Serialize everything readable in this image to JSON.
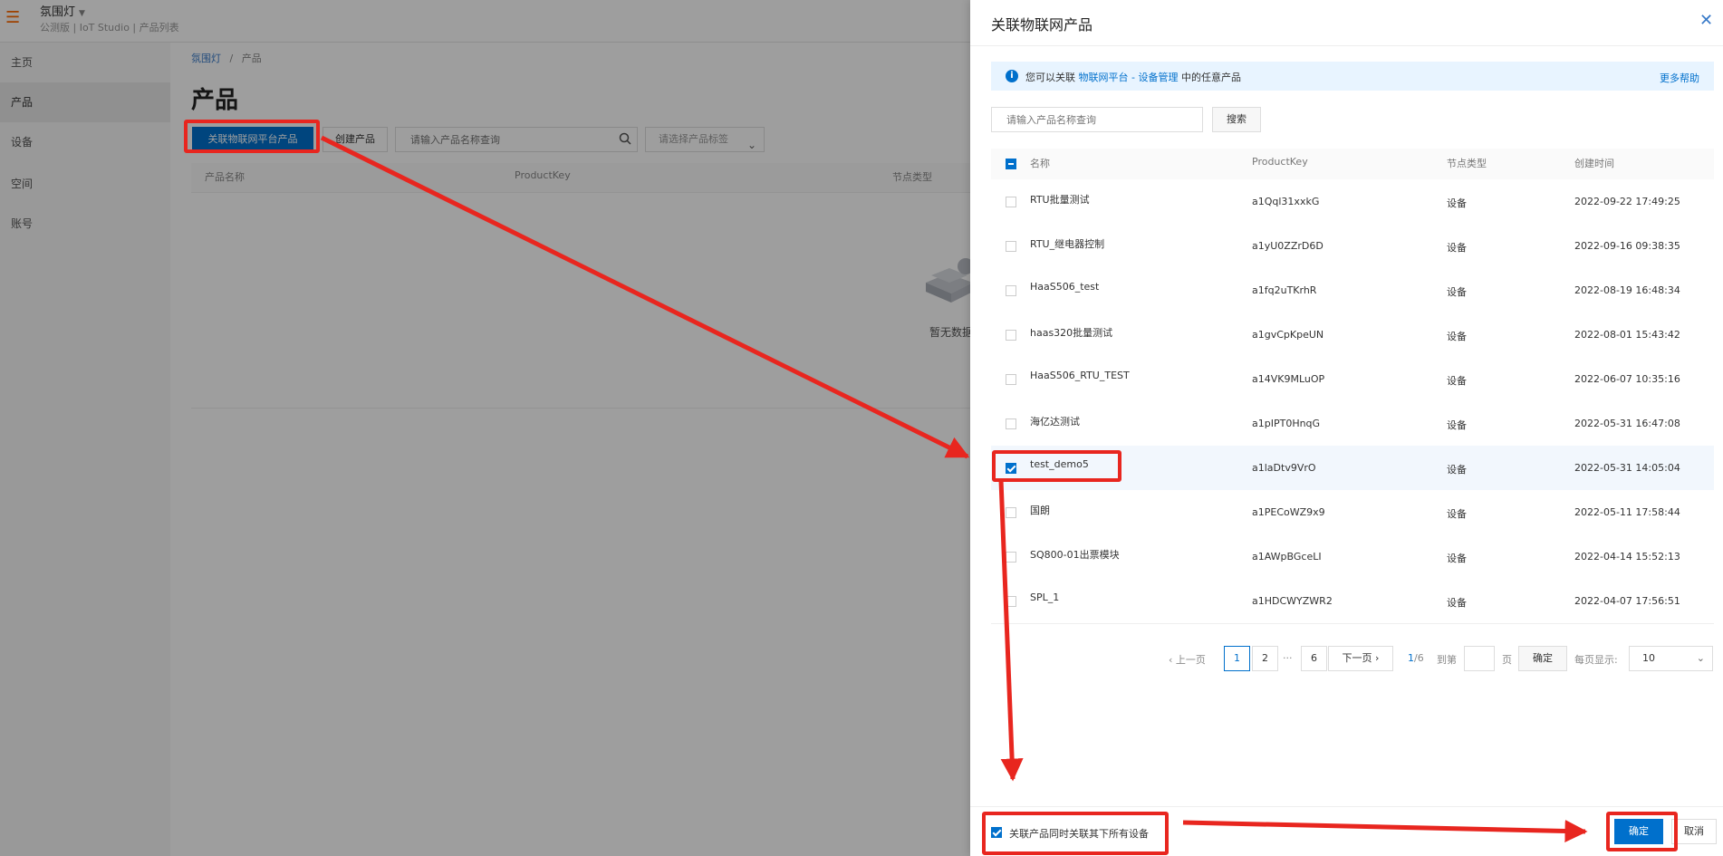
{
  "app": {
    "title": "氛围灯",
    "subtitle": "公测版 | IoT Studio | 产品列表"
  },
  "sidenav": {
    "items": [
      {
        "label": "主页"
      },
      {
        "label": "产品"
      },
      {
        "label": "设备"
      },
      {
        "label": "空间"
      },
      {
        "label": "账号"
      }
    ]
  },
  "breadcrumb": {
    "root": "氛围灯",
    "sep": "/",
    "current": "产品"
  },
  "page": {
    "title": "产品",
    "link_button": "关联物联网平台产品",
    "create_button": "创建产品",
    "search_placeholder": "请输入产品名称查询",
    "tag_select_placeholder": "请选择产品标签",
    "columns": [
      "产品名称",
      "ProductKey",
      "节点类型"
    ],
    "empty_text": "暂无数据"
  },
  "drawer": {
    "title": "关联物联网产品",
    "notice_prefix": "您可以关联",
    "notice_link": "物联网平台 - 设备管理",
    "notice_suffix": "中的任意产品",
    "more_help": "更多帮助",
    "search_placeholder": "请输入产品名称查询",
    "search_button": "搜索",
    "columns": [
      "名称",
      "ProductKey",
      "节点类型",
      "创建时间"
    ],
    "rows": [
      {
        "name": "RTU批量测试",
        "key": "a1Qql31xxkG",
        "type": "设备",
        "created": "2022-09-22 17:49:25",
        "checked": false
      },
      {
        "name": "RTU_继电器控制",
        "key": "a1yU0ZZrD6D",
        "type": "设备",
        "created": "2022-09-16 09:38:35",
        "checked": false
      },
      {
        "name": "HaaS506_test",
        "key": "a1fq2uTKrhR",
        "type": "设备",
        "created": "2022-08-19 16:48:34",
        "checked": false
      },
      {
        "name": "haas320批量测试",
        "key": "a1gvCpKpeUN",
        "type": "设备",
        "created": "2022-08-01 15:43:42",
        "checked": false
      },
      {
        "name": "HaaS506_RTU_TEST",
        "key": "a14VK9MLuOP",
        "type": "设备",
        "created": "2022-06-07 10:35:16",
        "checked": false
      },
      {
        "name": "海亿达测试",
        "key": "a1pIPT0HnqG",
        "type": "设备",
        "created": "2022-05-31 16:47:08",
        "checked": false
      },
      {
        "name": "test_demo5",
        "key": "a1laDtv9VrO",
        "type": "设备",
        "created": "2022-05-31 14:05:04",
        "checked": true
      },
      {
        "name": "国朗",
        "key": "a1PECoWZ9x9",
        "type": "设备",
        "created": "2022-05-11 17:58:44",
        "checked": false
      },
      {
        "name": "SQ800-01出票模块",
        "key": "a1AWpBGceLI",
        "type": "设备",
        "created": "2022-04-14 15:52:13",
        "checked": false
      },
      {
        "name": "SPL_1",
        "key": "a1HDCWYZWR2",
        "type": "设备",
        "created": "2022-04-07 17:56:51",
        "checked": false
      }
    ],
    "pagination": {
      "prev": "上一页",
      "pages": [
        "1",
        "2",
        "···",
        "6"
      ],
      "next": "下一页",
      "current": "1",
      "total_sep": "/6",
      "goto_label": "到第",
      "goto_unit": "页",
      "goto_button": "确定",
      "page_size_label": "每页显示:",
      "page_size": "10"
    },
    "footer": {
      "checkbox_label": "关联产品同时关联其下所有设备",
      "ok_button": "确定",
      "cancel_button": "取消"
    }
  },
  "colors": {
    "primary": "#0070cc",
    "annotation": "#e8261f",
    "menu_accent": "#ff6a00"
  }
}
